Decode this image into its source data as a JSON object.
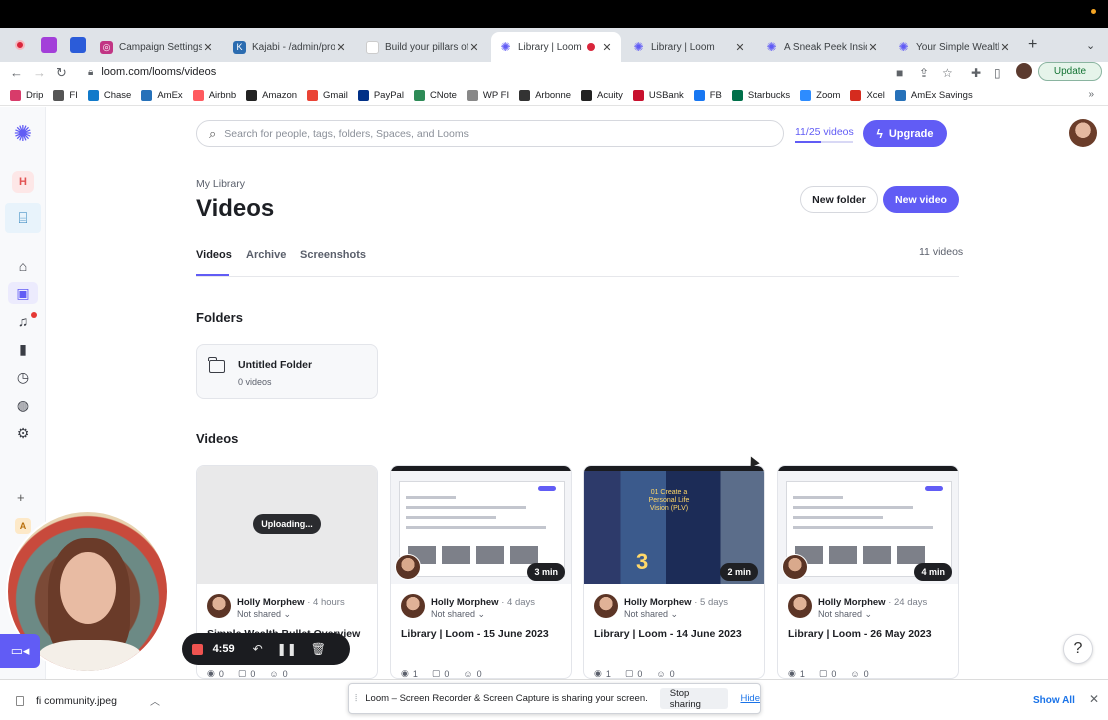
{
  "browser": {
    "tabs": [
      {
        "label": "Campaign Settings",
        "icon": "campaign-favicon",
        "color": "#c13584"
      },
      {
        "label": "Kajabi - /admin/prod",
        "icon": "kajabi-favicon",
        "color": "#2b6cb0"
      },
      {
        "label": "Build your pillars of",
        "icon": "doc-favicon",
        "color": "#9aa0a6"
      },
      {
        "label": "Library | Loom",
        "icon": "loom-favicon",
        "color": "#615cf5",
        "active": true
      },
      {
        "label": "Library | Loom",
        "icon": "loom-favicon",
        "color": "#615cf5"
      },
      {
        "label": "A Sneak Peek Inside",
        "icon": "loom-favicon",
        "color": "#615cf5"
      },
      {
        "label": "Your Simple Wealth",
        "icon": "loom-favicon",
        "color": "#615cf5"
      }
    ],
    "url": "loom.com/looms/videos",
    "update_label": "Update",
    "bookmarks": [
      {
        "label": "Drip",
        "color": "#d83b6a"
      },
      {
        "label": "FI",
        "color": "#555555"
      },
      {
        "label": "Chase",
        "color": "#117aca"
      },
      {
        "label": "AmEx",
        "color": "#2671b9"
      },
      {
        "label": "Airbnb",
        "color": "#ff5a5f"
      },
      {
        "label": "Amazon",
        "color": "#222222"
      },
      {
        "label": "Gmail",
        "color": "#ea4335"
      },
      {
        "label": "PayPal",
        "color": "#003087"
      },
      {
        "label": "CNote",
        "color": "#2e8b57"
      },
      {
        "label": "WP FI",
        "color": "#888888"
      },
      {
        "label": "Arbonne",
        "color": "#333333"
      },
      {
        "label": "Acuity",
        "color": "#222222"
      },
      {
        "label": "USBank",
        "color": "#c8102e"
      },
      {
        "label": "FB",
        "color": "#1877f2"
      },
      {
        "label": "Starbucks",
        "color": "#00704a"
      },
      {
        "label": "Zoom",
        "color": "#2d8cff"
      },
      {
        "label": "Xcel",
        "color": "#d52b1e"
      },
      {
        "label": "AmEx Savings",
        "color": "#2671b9"
      }
    ],
    "bookmarks_more": "»"
  },
  "rail": {
    "workspace_letter": "H",
    "space_letter": "A"
  },
  "search": {
    "placeholder": "Search for people, tags, folders, Spaces, and Looms"
  },
  "quota": {
    "label": "11/25 videos",
    "fraction": 0.44
  },
  "upgrade_label": "Upgrade",
  "header": {
    "breadcrumb": "My Library",
    "title": "Videos",
    "new_folder": "New folder",
    "new_video": "New video"
  },
  "page_tabs": [
    {
      "label": "Videos",
      "active": true
    },
    {
      "label": "Archive"
    },
    {
      "label": "Screenshots"
    }
  ],
  "video_count": "11 videos",
  "folders": {
    "heading": "Folders",
    "items": [
      {
        "name": "Untitled Folder",
        "count": "0 videos"
      }
    ]
  },
  "videos": {
    "heading": "Videos",
    "items": [
      {
        "status": "Uploading...",
        "author": "Holly Morphew",
        "time": "4 hours",
        "shared": "Not shared",
        "title": "Simple Wealth Bullet Overview",
        "views": "0",
        "comments": "0",
        "reactions": "0"
      },
      {
        "duration": "3 min",
        "author": "Holly Morphew",
        "time": "4 days",
        "shared": "Not shared",
        "title": "Library | Loom - 15 June 2023",
        "views": "1",
        "comments": "0",
        "reactions": "0"
      },
      {
        "duration": "2 min",
        "author": "Holly Morphew",
        "time": "5 days",
        "shared": "Not shared",
        "title": "Library | Loom - 14 June 2023",
        "views": "1",
        "comments": "0",
        "reactions": "0",
        "thumb_text": "01 Create a Personal Life Vision (PLV)",
        "thumb_num": "3"
      },
      {
        "duration": "4 min",
        "author": "Holly Morphew",
        "time": "24 days",
        "shared": "Not shared",
        "title": "Library | Loom - 26 May 2023",
        "views": "1",
        "comments": "0",
        "reactions": "0"
      }
    ]
  },
  "recorder": {
    "timer": "4:59"
  },
  "help_label": "?",
  "download": {
    "filename": "fi community.jpeg",
    "show_all": "Show All"
  },
  "share_bar": {
    "message": "Loom – Screen Recorder & Screen Capture is sharing your screen.",
    "stop": "Stop sharing",
    "hide": "Hide"
  },
  "colors": {
    "accent": "#615cf5",
    "record": "#ef5350"
  }
}
